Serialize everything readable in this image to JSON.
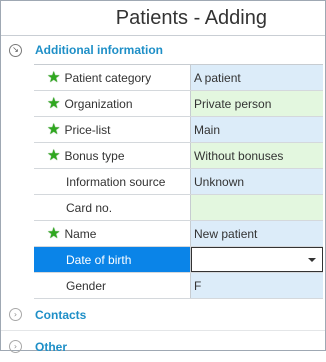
{
  "window": {
    "title": "Patients - Adding"
  },
  "groups": {
    "additional": {
      "label": "Additional information"
    },
    "contacts": {
      "label": "Contacts"
    },
    "other": {
      "label": "Other"
    }
  },
  "fields": [
    {
      "caption": "Patient category",
      "value": "A patient",
      "required": true,
      "color": "#dcecf9"
    },
    {
      "caption": "Organization",
      "value": "Private person",
      "required": true,
      "color": "#e3f7df"
    },
    {
      "caption": "Price-list",
      "value": "Main",
      "required": true,
      "color": "#dcecf9"
    },
    {
      "caption": "Bonus type",
      "value": "Without bonuses",
      "required": true,
      "color": "#e3f7df"
    },
    {
      "caption": "Information source",
      "value": "Unknown",
      "required": false,
      "color": "#dcecf9"
    },
    {
      "caption": "Card no.",
      "value": "",
      "required": false,
      "color": "#e3f7df"
    },
    {
      "caption": "Name",
      "value": "New patient",
      "required": true,
      "color": "#dcecf9"
    },
    {
      "caption": "Date of birth",
      "value": "",
      "required": false,
      "selected": true
    },
    {
      "caption": "Gender",
      "value": "F",
      "required": false,
      "color": "#dcecf9"
    }
  ],
  "icons": {
    "required": "star-icon",
    "expanded": "expand-arrow-icon",
    "collapsed": "chevron-right-icon"
  },
  "colors": {
    "accent": "#1e8fc7",
    "selection": "#0a84e8",
    "required_star": "#2fa81f"
  }
}
